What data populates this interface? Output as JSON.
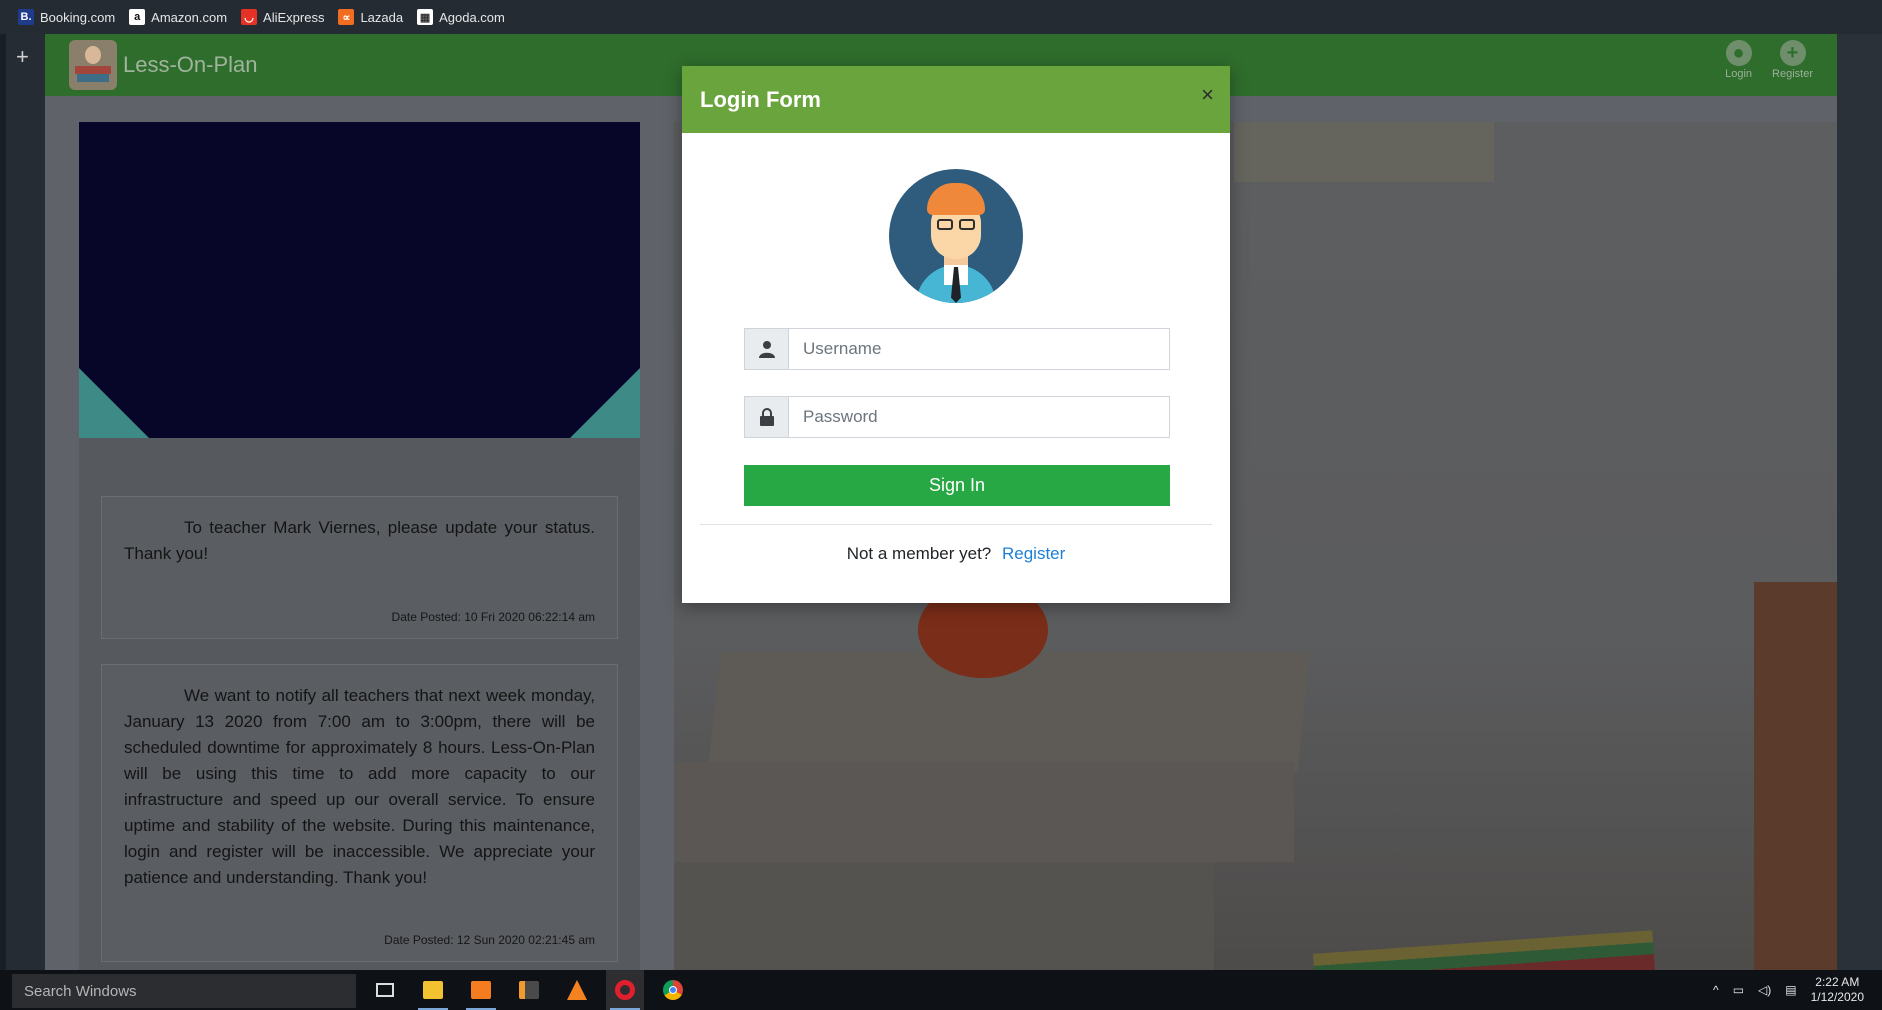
{
  "bookmarks": [
    {
      "label": "Booking.com",
      "icon": "booking-icon",
      "color": "#1f3b8c",
      "glyph": "B."
    },
    {
      "label": "Amazon.com",
      "icon": "amazon-icon",
      "color": "#ffffff",
      "glyph": "a"
    },
    {
      "label": "AliExpress",
      "icon": "aliexpress-icon",
      "color": "#e43225",
      "glyph": "◡"
    },
    {
      "label": "Lazada",
      "icon": "lazada-icon",
      "color": "#f26d21",
      "glyph": "∝"
    },
    {
      "label": "Agoda.com",
      "icon": "agoda-icon",
      "color": "#ffffff",
      "glyph": "▦"
    }
  ],
  "opera_sidebar": {
    "add_label": "+"
  },
  "navbar": {
    "brand": "Less-On-Plan",
    "login_label": "Login",
    "register_label": "Register",
    "color": "#2f6d2c"
  },
  "announcements": [
    {
      "text": "To teacher Mark Viernes, please update your status. Thank you!",
      "date": "Date Posted: 10 Fri 2020 06:22:14 am"
    },
    {
      "text": "We want to notify all teachers that next week monday, January 13 2020 from 7:00 am to 3:00pm, there will be scheduled downtime for approximately 8 hours. Less-On-Plan will be using this time to add more capacity to our infrastructure and speed up our overall service. To ensure uptime and stability of the website. During this maintenance, login and register will be inaccessible. We appreciate your patience and understanding. Thank you!",
      "date": "Date Posted: 12 Sun 2020 02:21:45 am"
    }
  ],
  "modal": {
    "title": "Login Form",
    "close_label": "×",
    "username_placeholder": "Username",
    "password_placeholder": "Password",
    "sign_in_label": "Sign In",
    "footer_text": "Not a member yet?",
    "register_link": "Register",
    "header_color": "#6aa43c",
    "button_color": "#28a745",
    "link_color": "#1e7fd8"
  },
  "taskbar": {
    "search_placeholder": "Search Windows",
    "apps": [
      "task-view-icon",
      "file-explorer-icon",
      "xampp-icon",
      "sublime-text-icon",
      "vlc-icon",
      "opera-icon",
      "chrome-icon"
    ],
    "time": "2:22 AM",
    "date": "1/12/2020"
  }
}
